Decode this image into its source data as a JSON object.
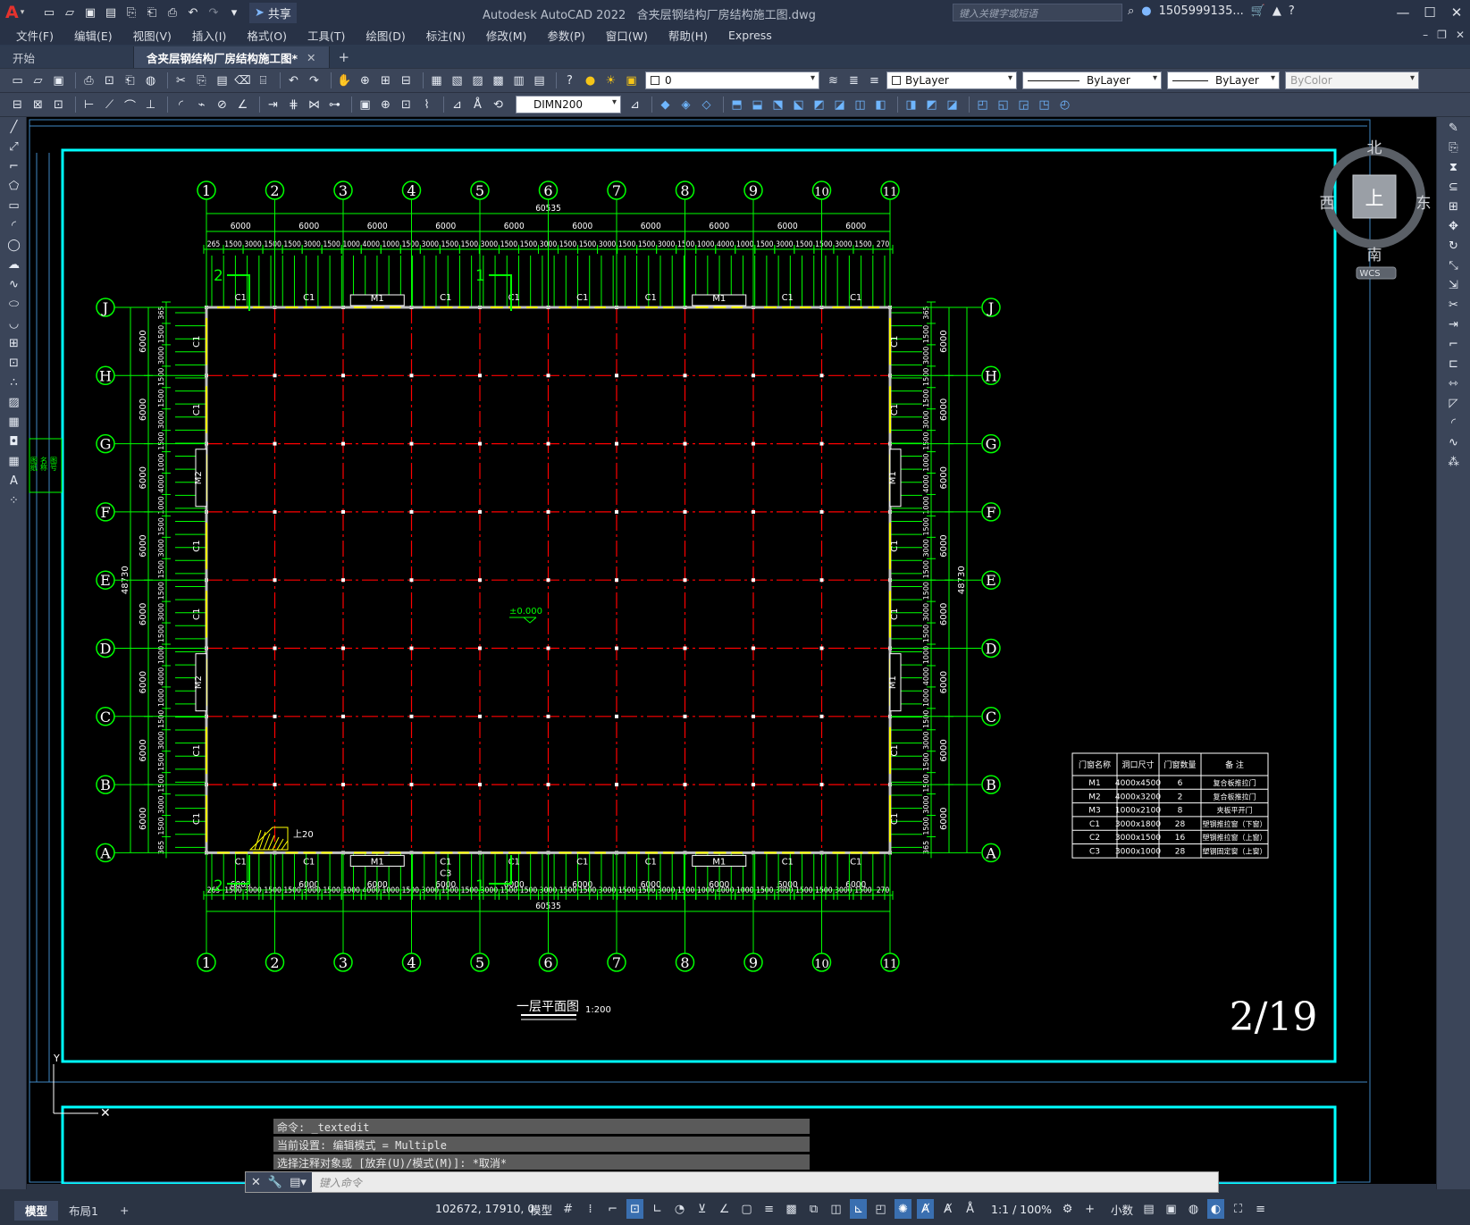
{
  "app": {
    "title": "Autodesk AutoCAD 2022",
    "file": "含夹层钢结构厂房结构施工图.dwg",
    "share": "共享",
    "search_placeholder": "键入关键字或短语",
    "user": "1505999135..."
  },
  "menu": [
    "文件(F)",
    "编辑(E)",
    "视图(V)",
    "插入(I)",
    "格式(O)",
    "工具(T)",
    "绘图(D)",
    "标注(N)",
    "修改(M)",
    "参数(P)",
    "窗口(W)",
    "帮助(H)",
    "Express"
  ],
  "tabs": {
    "start": "开始",
    "active": "含夹层钢结构厂房结构施工图*"
  },
  "toolbar": {
    "layer": "0",
    "color": "ByLayer",
    "linetype": "ByLayer",
    "lineweight": "ByLayer",
    "plotstyle": "ByColor",
    "dimstyle": "DIMN200"
  },
  "viewcube": {
    "north": "北",
    "south": "南",
    "east": "东",
    "west": "西",
    "top": "上",
    "wcs": "WCS"
  },
  "drawing": {
    "col_axes": [
      "1",
      "2",
      "3",
      "4",
      "5",
      "6",
      "7",
      "8",
      "9",
      "10",
      "11"
    ],
    "row_axes": [
      "J",
      "H",
      "G",
      "F",
      "E",
      "D",
      "C",
      "B",
      "A"
    ],
    "total_width": "60535",
    "total_depth": "48730",
    "bay_dims": [
      "6000",
      "6000",
      "6000",
      "6000",
      "6000",
      "6000",
      "6000",
      "6000",
      "6000",
      "6000"
    ],
    "top_detail": [
      "265",
      "1500",
      "3000",
      "1500",
      "1500",
      "3000",
      "1500",
      "1000",
      "4000",
      "1000",
      "1500",
      "3000",
      "1500",
      "1500",
      "3000",
      "1500",
      "1500",
      "3000",
      "1500",
      "1500",
      "3000",
      "1500",
      "1500",
      "3000",
      "1500",
      "1000",
      "4000",
      "1000",
      "1500",
      "3000",
      "1500",
      "1500",
      "3000",
      "1500",
      "270"
    ],
    "left_detail": [
      "365",
      "1500",
      "3000",
      "1500",
      "1500",
      "3000",
      "1500",
      "1000",
      "4000",
      "1000",
      "1500",
      "3000",
      "1500",
      "1500",
      "3000",
      "1500",
      "1000",
      "4000",
      "1000",
      "1500",
      "3000",
      "1500",
      "1500",
      "3000",
      "1500",
      "365"
    ],
    "top_openings": [
      "C1",
      "C1",
      "M1",
      "C1",
      "C1",
      "C1",
      "C1",
      "M1",
      "C1",
      "C1"
    ],
    "bottom_openings": [
      "C1",
      "C1",
      "M1",
      "C1",
      "C1",
      "C1",
      "C1",
      "M1",
      "C1",
      "C1"
    ],
    "bottom_extra": "C3",
    "side_windows": [
      "C1",
      "C1",
      "C1",
      "C1",
      "C1",
      "C1",
      "C1",
      "C1"
    ],
    "left_doors": [
      "M2",
      "M2"
    ],
    "right_doors": [
      "M1",
      "M1"
    ],
    "section_marks": [
      "2",
      "1"
    ],
    "elevation": "±0.000",
    "stair_label": "上20",
    "plan_title": "一层平面图",
    "plan_scale": "1:200",
    "sheet_no": "2/19",
    "schedule": {
      "headers": [
        "门窗名称",
        "洞口尺寸",
        "门窗数量",
        "备 注"
      ],
      "rows": [
        [
          "M1",
          "4000x4500",
          "6",
          "复合板推拉门"
        ],
        [
          "M2",
          "4000x3200",
          "2",
          "复合板推拉门"
        ],
        [
          "M3",
          "1000x2100",
          "8",
          "夹板平开门"
        ],
        [
          "C1",
          "3000x1800",
          "28",
          "塑钢推拉窗（下窗）"
        ],
        [
          "C2",
          "3000x1500",
          "16",
          "塑钢推拉窗（上窗）"
        ],
        [
          "C3",
          "3000x1000",
          "28",
          "塑钢固定窗（上窗）"
        ]
      ]
    },
    "side_labels": [
      "图纸",
      "名称",
      "图号"
    ]
  },
  "command": {
    "history": [
      "命令: _textedit",
      "当前设置: 编辑模式 = Multiple",
      "选择注释对象或 [放弃(U)/模式(M)]: *取消*"
    ],
    "placeholder": "键入命令"
  },
  "status": {
    "layout_tabs": [
      "模型",
      "布局1"
    ],
    "coords": "102672, 17910, 0",
    "mode": "模型",
    "scale": "1:1 / 100%",
    "units": "小数"
  }
}
